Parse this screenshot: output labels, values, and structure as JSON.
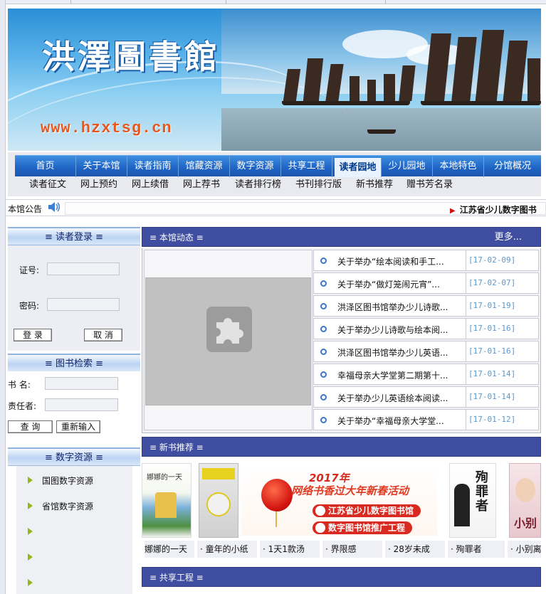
{
  "banner": {
    "title": "洪澤圖書館",
    "url": "www.hzxtsg.cn"
  },
  "nav": {
    "main": [
      "首页",
      "关于本馆",
      "读者指南",
      "馆藏资源",
      "数字资源",
      "共享工程",
      "读者园地",
      "少儿园地",
      "本地特色",
      "分馆概况"
    ],
    "active_index": 6,
    "sub": [
      "读者征文",
      "网上预约",
      "网上续借",
      "网上荐书",
      "读者排行榜",
      "书刊排行版",
      "新书推荐",
      "赠书芳名录"
    ]
  },
  "notice": {
    "label": "本馆公告",
    "marquee": "江苏省少儿数字图书"
  },
  "login": {
    "heading": "≡ 读者登录 ≡",
    "card_label": "证号:",
    "password_label": "密码:",
    "card_value": "",
    "password_value": "",
    "login_button": "登  录",
    "cancel_button": "取  消"
  },
  "search": {
    "heading": "≡ 图书检索 ≡",
    "title_label": "书  名:",
    "author_label": "责任者:",
    "title_value": "",
    "author_value": "",
    "query_button": "查  询",
    "reset_button": "重新输入"
  },
  "digital": {
    "heading": "≡ 数字资源 ≡",
    "items": [
      "国图数字资源",
      "省馆数字资源",
      "",
      "",
      ""
    ]
  },
  "news": {
    "heading": "≡ 本馆动态 ≡",
    "more": "更多...",
    "items": [
      {
        "title": "关于举办“绘本阅读和手工...",
        "date": "[17-02-09]"
      },
      {
        "title": "关于举办“做灯笼闹元宵”...",
        "date": "[17-02-07]"
      },
      {
        "title": "洪泽区图书馆举办少儿诗歌...",
        "date": "[17-01-19]"
      },
      {
        "title": "关于举办少儿诗歌与绘本阅...",
        "date": "[17-01-16]"
      },
      {
        "title": "洪泽区图书馆举办少儿英语...",
        "date": "[17-01-16]"
      },
      {
        "title": "幸福母亲大学堂第二期第十...",
        "date": "[17-01-14]"
      },
      {
        "title": "关于举办少儿英语绘本阅读...",
        "date": "[17-01-14]"
      },
      {
        "title": "关于举办“幸福母亲大学堂...",
        "date": "[17-01-12]"
      }
    ]
  },
  "books": {
    "heading": "≡ 新书推荐 ≡",
    "captions": [
      "娜娜的一天",
      "· 童年的小纸",
      "· 1天1款汤",
      "· 界限感",
      "· 28岁未成",
      "· 殉罪者",
      "· 小别离"
    ],
    "cover_texts": {
      "book1": "娜娜的一天",
      "book6": "殉罪者",
      "book7": "小别"
    },
    "promo": {
      "year": "2017年",
      "headline": "网络书香过大年新春活动",
      "pill1": "江苏省少儿数字图书馆",
      "pill2": "数字图书馆推广工程"
    }
  },
  "share": {
    "heading": "≡ 共享工程 ≡"
  },
  "colors": {
    "panel_head": "#3f4ea0",
    "nav_blue": "#1f63c4",
    "date_text": "#5b98cf",
    "url_orange": "#e8561f"
  }
}
